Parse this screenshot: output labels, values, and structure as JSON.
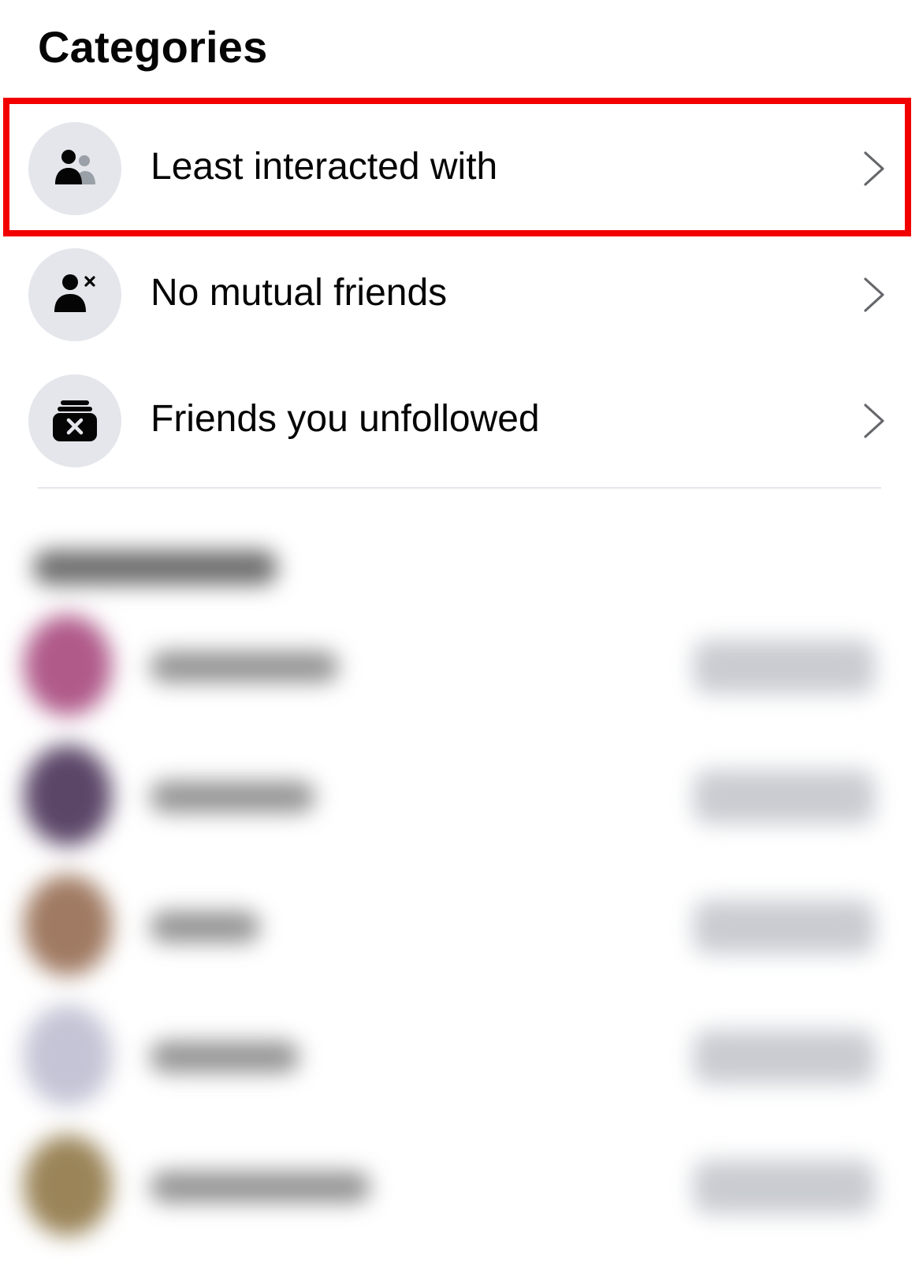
{
  "header": {
    "title": "Categories"
  },
  "categories": [
    {
      "label": "Least interacted with",
      "icon": "friends-group-icon"
    },
    {
      "label": "No mutual friends",
      "icon": "person-remove-icon"
    },
    {
      "label": "Friends you unfollowed",
      "icon": "unfollow-box-icon"
    }
  ],
  "highlight_color": "#f20000",
  "icon_background": "#e4e6eb",
  "blurred_friends": {
    "row_count": 5,
    "avatar_colors": [
      "#b05a8a",
      "#5b4668",
      "#a07a62",
      "#c4c4d6",
      "#9a8458"
    ]
  }
}
